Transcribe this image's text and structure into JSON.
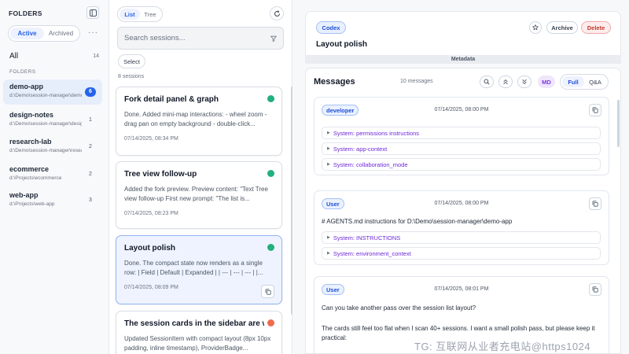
{
  "sidebar": {
    "heading": "FOLDERS",
    "tabs": [
      "Active",
      "Archived"
    ],
    "all_label": "All",
    "all_count": "14",
    "section_label": "FOLDERS",
    "folders": [
      {
        "name": "demo-app",
        "path": "d:\\Demo\\session-manager\\demo-app",
        "count": "6"
      },
      {
        "name": "design-notes",
        "path": "d:\\Demo\\session-manager\\design-notes",
        "count": "1"
      },
      {
        "name": "research-lab",
        "path": "d:\\Demo\\session-manager\\research-lab",
        "count": "2"
      },
      {
        "name": "ecommerce",
        "path": "d:\\Projects\\ecommerce",
        "count": "2"
      },
      {
        "name": "web-app",
        "path": "d:\\Projects\\web-app",
        "count": "3"
      }
    ]
  },
  "sessions": {
    "view_tabs": [
      "List",
      "Tree"
    ],
    "search_placeholder": "Search sessions...",
    "select_label": "Select",
    "count_text": "8 sessions",
    "cards": [
      {
        "title": "Fork detail panel & graph",
        "desc": "Done. Added mini-map interactions: - wheel zoom - drag pan on empty background - double-click...",
        "time": "07/14/2025, 08:34 PM"
      },
      {
        "title": "Tree view follow-up",
        "desc": "Added the fork preview. Preview content: \"Text Tree view follow-up First new prompt: \"The list is...",
        "time": "07/14/2025, 08:23 PM"
      },
      {
        "title": "Layout polish",
        "desc": "Done. The compact state now renders as a single row: | Field | Default | Expanded | | --- | --- | --- | |...",
        "time": "07/14/2025, 08:09 PM"
      },
      {
        "title": "The session cards in the sidebar are w",
        "desc": "Updated SessionItem with compact layout (8px 10px padding, inline timestamp), ProviderBadge...",
        "time": ""
      }
    ]
  },
  "detail": {
    "provider": "Codex",
    "archive_label": "Archive",
    "delete_label": "Delete",
    "title": "Layout polish",
    "metadata_label": "Metadata",
    "messages_title": "Messages",
    "messages_count": "10 messages",
    "md_label": "MD",
    "view_tabs": [
      "Full",
      "Q&A"
    ],
    "messages": [
      {
        "role": "developer",
        "time": "07/14/2025, 08:00 PM",
        "sections": [
          "System: permissions instructions",
          "System: app-context",
          "System: collaboration_mode"
        ]
      },
      {
        "role": "User",
        "time": "07/14/2025, 08:00 PM",
        "text": "# AGENTS.md instructions for D:\\Demo\\session-manager\\demo-app",
        "sections": [
          "System: INSTRUCTIONS",
          "System: environment_context"
        ]
      },
      {
        "role": "User",
        "time": "07/14/2025, 08:01 PM",
        "text": "Can you take another pass over the session list layout?",
        "text2": "The cards still feel too flat when I scan 40+ sessions. I want a small polish pass, but please keep it practical:"
      }
    ]
  },
  "watermark": "TG: 互联网从业者充电站@https1024"
}
